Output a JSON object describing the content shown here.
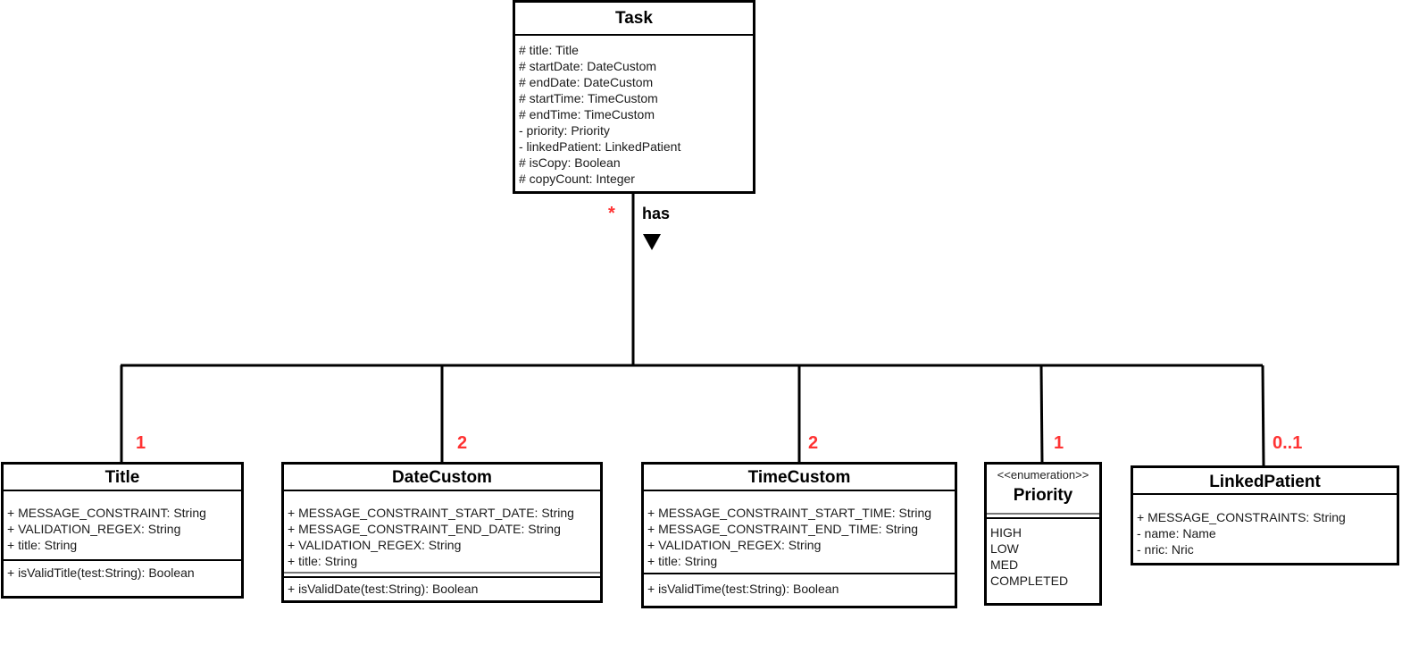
{
  "diagram": {
    "classes": {
      "task": {
        "name": "Task",
        "attributes": [
          "# title: Title",
          "# startDate: DateCustom",
          "# endDate: DateCustom",
          "# startTime: TimeCustom",
          "# endTime: TimeCustom",
          "- priority: Priority",
          "- linkedPatient: LinkedPatient",
          "# isCopy: Boolean",
          "# copyCount: Integer"
        ]
      },
      "title": {
        "name": "Title",
        "attributes": [
          "+ MESSAGE_CONSTRAINT: String",
          "+ VALIDATION_REGEX: String",
          "+ title: String"
        ],
        "methods": [
          "+ isValidTitle(test:String): Boolean"
        ]
      },
      "date_custom": {
        "name": "DateCustom",
        "attributes": [
          "+ MESSAGE_CONSTRAINT_START_DATE: String",
          "+ MESSAGE_CONSTRAINT_END_DATE: String",
          "+ VALIDATION_REGEX: String",
          "+ title: String"
        ],
        "methods": [
          "+ isValidDate(test:String): Boolean"
        ]
      },
      "time_custom": {
        "name": "TimeCustom",
        "attributes": [
          "+ MESSAGE_CONSTRAINT_START_TIME: String",
          "+ MESSAGE_CONSTRAINT_END_TIME: String",
          "+ VALIDATION_REGEX: String",
          "+ title: String"
        ],
        "methods": [
          "+ isValidTime(test:String): Boolean"
        ]
      },
      "priority": {
        "stereotype": "<<enumeration>>",
        "name": "Priority",
        "values": [
          "HIGH",
          "LOW",
          "MED",
          "COMPLETED"
        ]
      },
      "linked_patient": {
        "name": "LinkedPatient",
        "attributes": [
          "+ MESSAGE_CONSTRAINTS: String",
          "- name: Name",
          "- nric: Nric"
        ]
      }
    },
    "association": {
      "label": "has",
      "source_multiplicity": "*",
      "multiplicities": {
        "title": "1",
        "date_custom": "2",
        "time_custom": "2",
        "priority": "1",
        "linked_patient": "0..1"
      }
    },
    "colors": {
      "multiplicity": "#ff3333",
      "line": "#000000"
    }
  }
}
